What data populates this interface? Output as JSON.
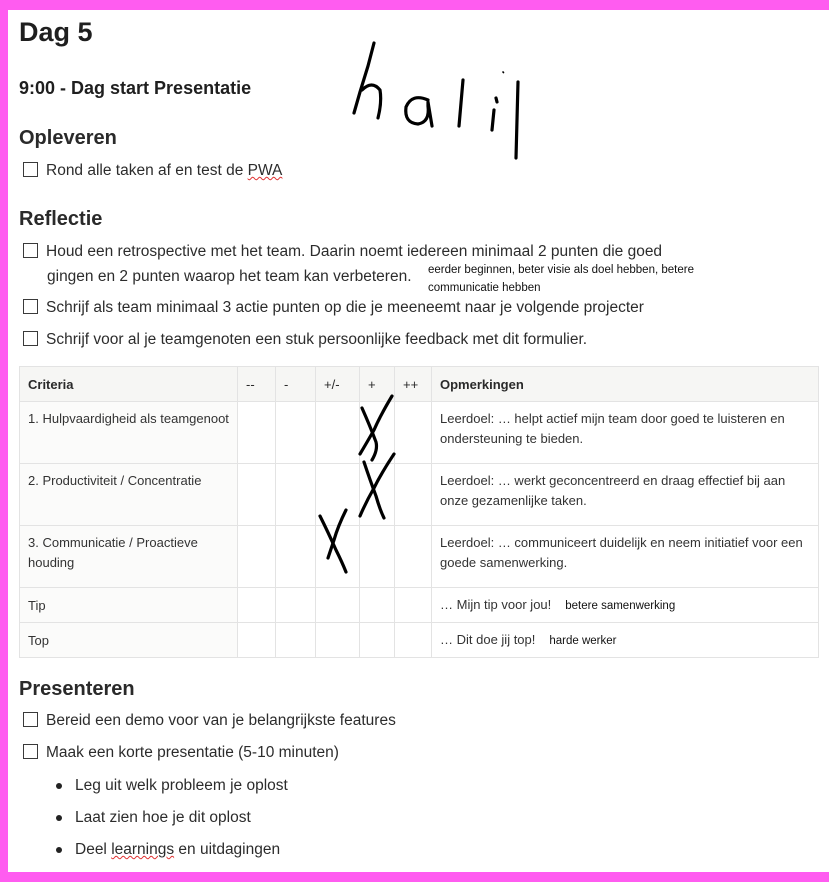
{
  "doc": {
    "title": "Dag 5",
    "subtitle": "9:00 - Dag start Presentatie",
    "handwritten_greeting": "halil"
  },
  "opleveren": {
    "heading": "Opleveren",
    "items": [
      {
        "text_before": "Rond alle taken af en test de ",
        "spell_word": "PWA",
        "text_after": "",
        "checked": false
      }
    ]
  },
  "reflectie": {
    "heading": "Reflectie",
    "item1_line1": "Houd een retrospective met het team. Daarin noemt iedereen minimaal 2 punten die goed",
    "item1_line2": "gingen en 2 punten waarop het team kan verbeteren.",
    "item1_note_line1": "eerder beginnen, beter visie als doel hebben, betere",
    "item1_note_line2": "communicatie hebben",
    "item2": "Schrijf als team minimaal 3 actie punten op die je meeneemt naar je volgende projecter",
    "item3": "Schrijf voor al je teamgenoten een stuk persoonlijke feedback met dit formulier."
  },
  "table": {
    "headers": [
      "Criteria",
      "--",
      "-",
      "+/-",
      "+",
      "++",
      "Opmerkingen"
    ],
    "rows": [
      {
        "criteria": "1. Hulpvaardigheid als teamgenoot",
        "remark": "Leerdoel: … helpt actief mijn team door goed te luisteren en ondersteuning te bieden.",
        "note": "",
        "mark": "+"
      },
      {
        "criteria": "2. Productiviteit / Concentratie",
        "remark": "Leerdoel: … werkt geconcentreerd en draag effectief bij aan onze gezamenlijke taken.",
        "note": "",
        "mark": "+"
      },
      {
        "criteria": "3. Communicatie / Proactieve houding",
        "remark": "Leerdoel: … communiceert duidelijk en neem initiatief voor een goede samenwerking.",
        "note": "",
        "mark": "+/-"
      },
      {
        "criteria": "Tip",
        "remark": "… Mijn tip voor jou!",
        "note": "betere samenwerking",
        "mark": ""
      },
      {
        "criteria": "Top",
        "remark": "… Dit doe jij top!",
        "note": "harde werker",
        "mark": ""
      }
    ]
  },
  "presenteren": {
    "heading": "Presenteren",
    "item1": "Bereid een demo voor van je belangrijkste features",
    "item2": "Maak een korte presentatie (5-10 minuten)",
    "bullets": [
      {
        "text_before": "Leg uit welk probleem je oplost",
        "spell_word": "",
        "text_after": ""
      },
      {
        "text_before": "Laat zien hoe je dit oplost",
        "spell_word": "",
        "text_after": ""
      },
      {
        "text_before": "Deel ",
        "spell_word": "learnings",
        "text_after": " en uitdagingen"
      }
    ]
  },
  "colors": {
    "frame": "#ff5cf0",
    "ink": "#000000",
    "spellcheck": "#e03030"
  }
}
